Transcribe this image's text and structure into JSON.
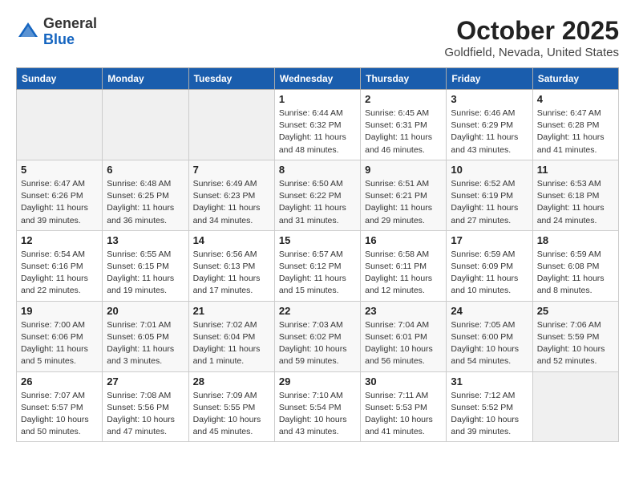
{
  "header": {
    "logo_line1": "General",
    "logo_line2": "Blue",
    "month": "October 2025",
    "location": "Goldfield, Nevada, United States"
  },
  "weekdays": [
    "Sunday",
    "Monday",
    "Tuesday",
    "Wednesday",
    "Thursday",
    "Friday",
    "Saturday"
  ],
  "weeks": [
    [
      {
        "day": "",
        "info": ""
      },
      {
        "day": "",
        "info": ""
      },
      {
        "day": "",
        "info": ""
      },
      {
        "day": "1",
        "info": "Sunrise: 6:44 AM\nSunset: 6:32 PM\nDaylight: 11 hours\nand 48 minutes."
      },
      {
        "day": "2",
        "info": "Sunrise: 6:45 AM\nSunset: 6:31 PM\nDaylight: 11 hours\nand 46 minutes."
      },
      {
        "day": "3",
        "info": "Sunrise: 6:46 AM\nSunset: 6:29 PM\nDaylight: 11 hours\nand 43 minutes."
      },
      {
        "day": "4",
        "info": "Sunrise: 6:47 AM\nSunset: 6:28 PM\nDaylight: 11 hours\nand 41 minutes."
      }
    ],
    [
      {
        "day": "5",
        "info": "Sunrise: 6:47 AM\nSunset: 6:26 PM\nDaylight: 11 hours\nand 39 minutes."
      },
      {
        "day": "6",
        "info": "Sunrise: 6:48 AM\nSunset: 6:25 PM\nDaylight: 11 hours\nand 36 minutes."
      },
      {
        "day": "7",
        "info": "Sunrise: 6:49 AM\nSunset: 6:23 PM\nDaylight: 11 hours\nand 34 minutes."
      },
      {
        "day": "8",
        "info": "Sunrise: 6:50 AM\nSunset: 6:22 PM\nDaylight: 11 hours\nand 31 minutes."
      },
      {
        "day": "9",
        "info": "Sunrise: 6:51 AM\nSunset: 6:21 PM\nDaylight: 11 hours\nand 29 minutes."
      },
      {
        "day": "10",
        "info": "Sunrise: 6:52 AM\nSunset: 6:19 PM\nDaylight: 11 hours\nand 27 minutes."
      },
      {
        "day": "11",
        "info": "Sunrise: 6:53 AM\nSunset: 6:18 PM\nDaylight: 11 hours\nand 24 minutes."
      }
    ],
    [
      {
        "day": "12",
        "info": "Sunrise: 6:54 AM\nSunset: 6:16 PM\nDaylight: 11 hours\nand 22 minutes."
      },
      {
        "day": "13",
        "info": "Sunrise: 6:55 AM\nSunset: 6:15 PM\nDaylight: 11 hours\nand 19 minutes."
      },
      {
        "day": "14",
        "info": "Sunrise: 6:56 AM\nSunset: 6:13 PM\nDaylight: 11 hours\nand 17 minutes."
      },
      {
        "day": "15",
        "info": "Sunrise: 6:57 AM\nSunset: 6:12 PM\nDaylight: 11 hours\nand 15 minutes."
      },
      {
        "day": "16",
        "info": "Sunrise: 6:58 AM\nSunset: 6:11 PM\nDaylight: 11 hours\nand 12 minutes."
      },
      {
        "day": "17",
        "info": "Sunrise: 6:59 AM\nSunset: 6:09 PM\nDaylight: 11 hours\nand 10 minutes."
      },
      {
        "day": "18",
        "info": "Sunrise: 6:59 AM\nSunset: 6:08 PM\nDaylight: 11 hours\nand 8 minutes."
      }
    ],
    [
      {
        "day": "19",
        "info": "Sunrise: 7:00 AM\nSunset: 6:06 PM\nDaylight: 11 hours\nand 5 minutes."
      },
      {
        "day": "20",
        "info": "Sunrise: 7:01 AM\nSunset: 6:05 PM\nDaylight: 11 hours\nand 3 minutes."
      },
      {
        "day": "21",
        "info": "Sunrise: 7:02 AM\nSunset: 6:04 PM\nDaylight: 11 hours\nand 1 minute."
      },
      {
        "day": "22",
        "info": "Sunrise: 7:03 AM\nSunset: 6:02 PM\nDaylight: 10 hours\nand 59 minutes."
      },
      {
        "day": "23",
        "info": "Sunrise: 7:04 AM\nSunset: 6:01 PM\nDaylight: 10 hours\nand 56 minutes."
      },
      {
        "day": "24",
        "info": "Sunrise: 7:05 AM\nSunset: 6:00 PM\nDaylight: 10 hours\nand 54 minutes."
      },
      {
        "day": "25",
        "info": "Sunrise: 7:06 AM\nSunset: 5:59 PM\nDaylight: 10 hours\nand 52 minutes."
      }
    ],
    [
      {
        "day": "26",
        "info": "Sunrise: 7:07 AM\nSunset: 5:57 PM\nDaylight: 10 hours\nand 50 minutes."
      },
      {
        "day": "27",
        "info": "Sunrise: 7:08 AM\nSunset: 5:56 PM\nDaylight: 10 hours\nand 47 minutes."
      },
      {
        "day": "28",
        "info": "Sunrise: 7:09 AM\nSunset: 5:55 PM\nDaylight: 10 hours\nand 45 minutes."
      },
      {
        "day": "29",
        "info": "Sunrise: 7:10 AM\nSunset: 5:54 PM\nDaylight: 10 hours\nand 43 minutes."
      },
      {
        "day": "30",
        "info": "Sunrise: 7:11 AM\nSunset: 5:53 PM\nDaylight: 10 hours\nand 41 minutes."
      },
      {
        "day": "31",
        "info": "Sunrise: 7:12 AM\nSunset: 5:52 PM\nDaylight: 10 hours\nand 39 minutes."
      },
      {
        "day": "",
        "info": ""
      }
    ]
  ]
}
